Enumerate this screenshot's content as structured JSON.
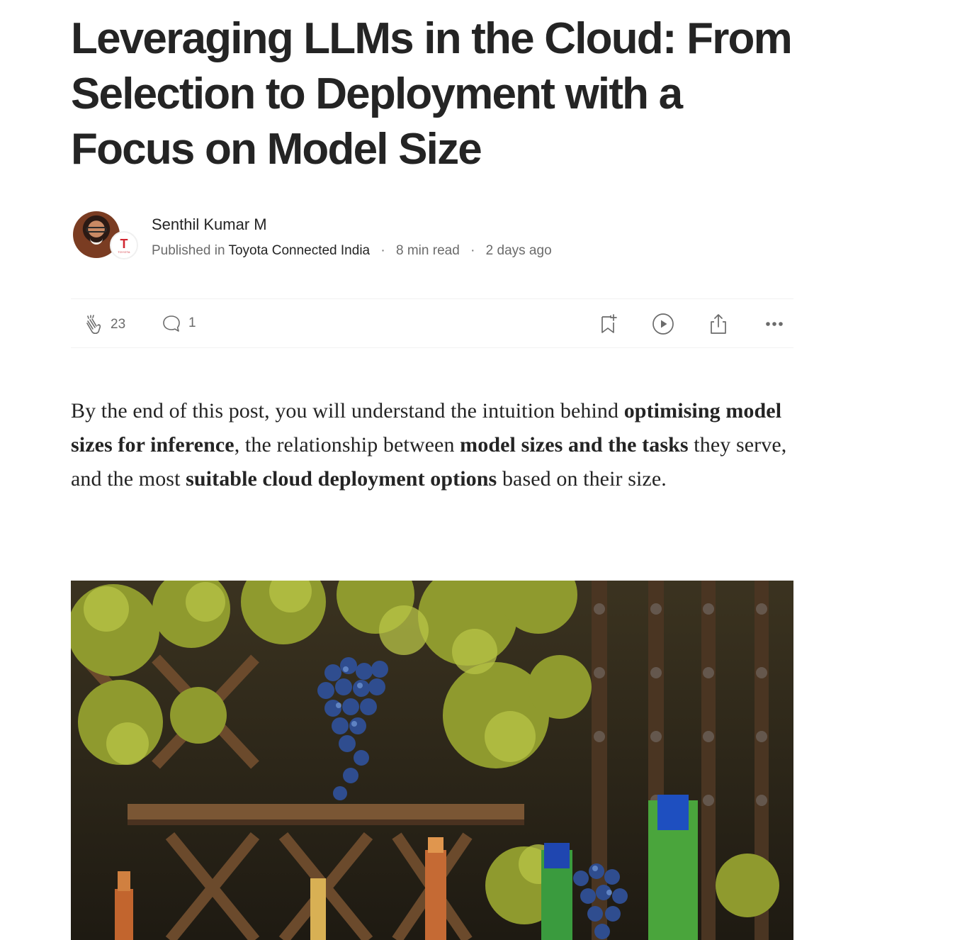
{
  "article": {
    "title": "Leveraging LLMs in the Cloud: From Selection to Deployment with a Focus on Model Size",
    "author": "Senthil Kumar M",
    "published_in_label": "Published in",
    "publication": "Toyota Connected India",
    "separator": "·",
    "read_time": "8 min read",
    "date": "2 days ago",
    "publication_logo_letter": "T",
    "publication_logo_text": "TOYOTA"
  },
  "actions": {
    "clap_count": "23",
    "comment_count": "1"
  },
  "intro": {
    "t1": "By the end of this post, you will understand the intuition behind ",
    "b1": "optimising model sizes for inference",
    "t2": ", the relationship between ",
    "b2": "model sizes and the tasks",
    "t3": " they serve, and the most ",
    "b3": "suitable cloud deployment options",
    "t4": " based on their size."
  },
  "colors": {
    "text_primary": "#242424",
    "text_secondary": "#6b6b6b",
    "divider": "#f2f2f2",
    "brand_red": "#d12631"
  }
}
